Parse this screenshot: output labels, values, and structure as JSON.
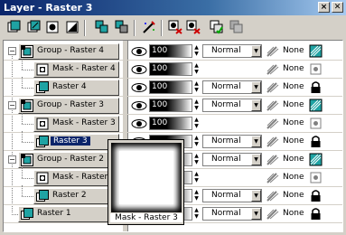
{
  "window": {
    "title": "Layer - Raster 3",
    "controls": [
      "×",
      "✕"
    ]
  },
  "toolbar": {
    "tools": [
      "new-raster-layer",
      "new-vector-layer",
      "new-mask-layer",
      "new-adjustment-layer",
      "new-group-layer",
      "delete-layer",
      "properties",
      "toggle-visibility",
      "toggle-mask",
      "show-all",
      "hide-all"
    ]
  },
  "layers": [
    {
      "name": "Group - Raster 4",
      "type": "group",
      "indent": 0,
      "expanded": true,
      "opacity": "100",
      "blend": "Normal",
      "link": "None",
      "selected": false
    },
    {
      "name": "Mask - Raster 4",
      "type": "mask",
      "indent": 1,
      "opacity": "100",
      "blend": "",
      "link": "None",
      "selected": false
    },
    {
      "name": "Raster 4",
      "type": "raster",
      "indent": 1,
      "opacity": "100",
      "blend": "Normal",
      "link": "None",
      "selected": false
    },
    {
      "name": "Group - Raster 3",
      "type": "group",
      "indent": 0,
      "expanded": true,
      "opacity": "100",
      "blend": "Normal",
      "link": "None",
      "selected": false
    },
    {
      "name": "Mask - Raster 3",
      "type": "mask",
      "indent": 1,
      "opacity": "100",
      "blend": "",
      "link": "None",
      "selected": false
    },
    {
      "name": "Raster 3",
      "type": "raster",
      "indent": 1,
      "opacity": "",
      "blend": "Normal",
      "link": "None",
      "selected": true
    },
    {
      "name": "Group - Raster 2",
      "type": "group",
      "indent": 0,
      "expanded": true,
      "opacity": "",
      "blend": "Normal",
      "link": "None",
      "selected": false
    },
    {
      "name": "Mask - Raster 2",
      "type": "mask",
      "indent": 1,
      "opacity": "",
      "blend": "",
      "link": "None",
      "selected": false
    },
    {
      "name": "Raster 2",
      "type": "raster",
      "indent": 1,
      "opacity": "",
      "blend": "Normal",
      "link": "None",
      "selected": false
    },
    {
      "name": "Raster 1",
      "type": "raster",
      "indent": 0,
      "opacity": "",
      "blend": "Normal",
      "link": "None",
      "selected": false
    }
  ],
  "tooltip": {
    "label": "Mask - Raster 3"
  },
  "colors": {
    "title_start": "#0a246a",
    "title_end": "#a6caf0",
    "selection": "#0a246a",
    "face": "#d4d0c8"
  }
}
